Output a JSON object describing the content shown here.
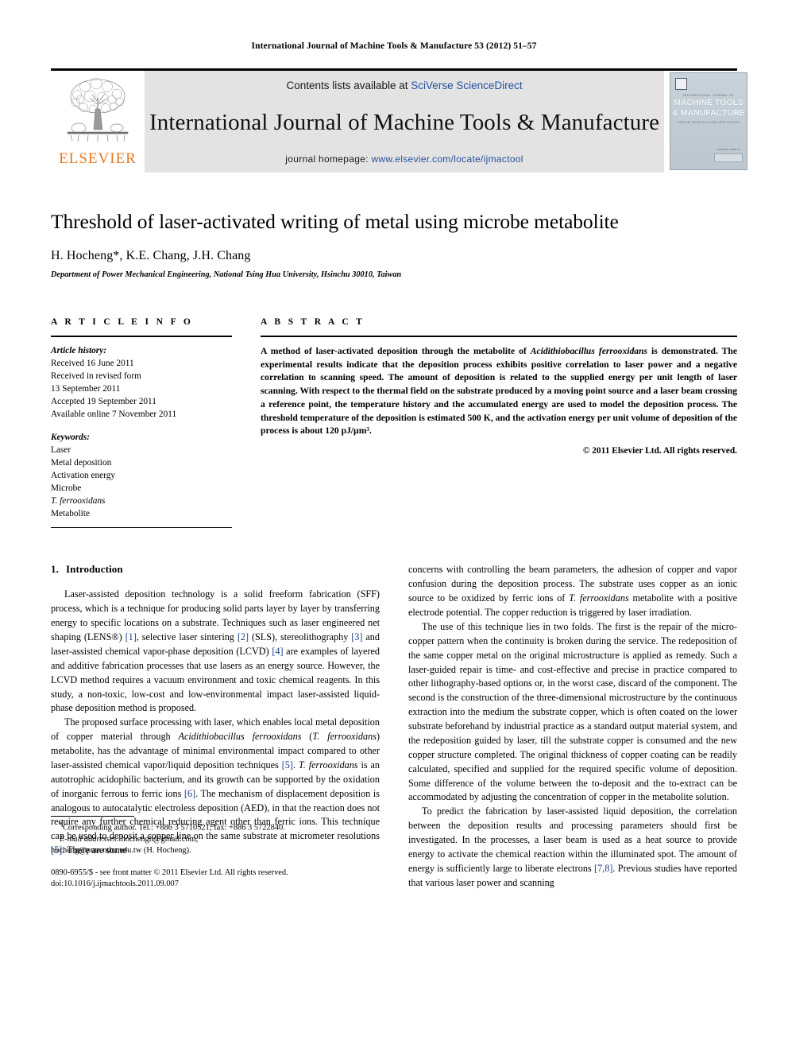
{
  "running_head": "International Journal of Machine Tools & Manufacture 53 (2012) 51–57",
  "masthead": {
    "publisher_name": "ELSEVIER",
    "contents_prefix": "Contents lists available at ",
    "contents_link": "SciVerse ScienceDirect",
    "journal_title": "International Journal of Machine Tools & Manufacture",
    "homepage_prefix": "journal homepage: ",
    "homepage_url": "www.elsevier.com/locate/ijmactool",
    "cover": {
      "kicker": "INTERNATIONAL JOURNAL OF",
      "title_line1": "MACHINE TOOLS",
      "title_line2": "& MANUFACTURE",
      "subtitle": "DESIGN, RESEARCH AND APPLICATION",
      "footer_label": "available online at",
      "footer_brand": "ScienceDirect"
    }
  },
  "article": {
    "title": "Threshold of laser-activated writing of metal using microbe metabolite",
    "authors": "H. Hocheng*, K.E. Chang, J.H. Chang",
    "affiliation": "Department of Power Mechanical Engineering, National Tsing Hua University, Hsinchu 30010, Taiwan"
  },
  "article_info": {
    "heading": "A R T I C L E    I N F O",
    "history_label": "Article history:",
    "history": [
      "Received 16 June 2011",
      "Received in revised form",
      "13 September 2011",
      "Accepted 19 September 2011",
      "Available online 7 November 2011"
    ],
    "keywords_label": "Keywords:",
    "keywords": [
      "Laser",
      "Metal deposition",
      "Activation energy",
      "Microbe",
      "T. ferrooxidans",
      "Metabolite"
    ]
  },
  "abstract": {
    "heading": "A B S T R A C T",
    "text_part1": "A method of laser-activated deposition through the metabolite of ",
    "organism": "Acidithiobacillus ferrooxidans",
    "text_part2": " is demonstrated. The experimental results indicate that the deposition process exhibits positive correlation to laser power and a negative correlation to scanning speed. The amount of deposition is related to the supplied energy per unit length of laser scanning. With respect to the thermal field on the substrate produced by a moving point source and a laser beam crossing a reference point, the temperature history and the accumulated energy are used to model the deposition process. The threshold temperature of the deposition is estimated 500 K, and the activation energy per unit volume of deposition of the process is about 120 pJ/µm³.",
    "copyright": "© 2011 Elsevier Ltd. All rights reserved."
  },
  "introduction": {
    "number": "1.",
    "title": "Introduction",
    "left_p1_a": "Laser-assisted deposition technology is a solid freeform fabrication (SFF) process, which is a technique for producing solid parts layer by layer by transferring energy to specific locations on a substrate. Techniques such as laser engineered net shaping (LENS®) ",
    "left_p1_r1": "[1]",
    "left_p1_b": ", selective laser sintering ",
    "left_p1_r2": "[2]",
    "left_p1_c": " (SLS), stereolithography ",
    "left_p1_r3": "[3]",
    "left_p1_d": " and laser-assisted chemical vapor-phase deposition (LCVD) ",
    "left_p1_r4": "[4]",
    "left_p1_e": " are examples of layered and additive fabrication processes that use lasers as an energy source. However, the LCVD method requires a vacuum environment and toxic chemical reagents. In this study, a non-toxic, low-cost and low-environmental impact laser-assisted liquid-phase deposition method is proposed.",
    "left_p2_a": "The proposed surface processing with laser, which enables local metal deposition of copper material through ",
    "left_p2_org1": "Acidithiobacillus ferrooxidans",
    "left_p2_b": " (",
    "left_p2_org2": "T. ferrooxidans",
    "left_p2_c": ") metabolite, has the advantage of minimal environmental impact compared to other laser-assisted chemical vapor/liquid deposition techniques ",
    "left_p2_r1": "[5]",
    "left_p2_d": ". ",
    "left_p2_org3": "T. ferrooxidans",
    "left_p2_e": " is an autotrophic acidophilic bacterium, and its growth can be supported by the oxidation of inorganic ferrous to ferric ions ",
    "left_p2_r2": "[6]",
    "left_p2_f": ". The mechanism of displacement deposition is analogous to autocatalytic electroless deposition (AED), in that the reaction does not require any further chemical reducing agent other than ferric ions. This technique can be used to deposit a copper line on the same substrate at micrometer resolutions ",
    "left_p2_r3": "[5]",
    "left_p2_g": ". There are some",
    "right_p1_a": "concerns with controlling the beam parameters, the adhesion of copper and vapor confusion during the deposition process. The substrate uses copper as an ionic source to be oxidized by ferric ions of ",
    "right_p1_org": "T. ferrooxidans",
    "right_p1_b": " metabolite with a positive electrode potential. The copper reduction is triggered by laser irradiation.",
    "right_p2": "The use of this technique lies in two folds. The first is the repair of the micro-copper pattern when the continuity is broken during the service. The redeposition of the same copper metal on the original microstructure is applied as remedy. Such a laser-guided repair is time- and cost-effective and precise in practice compared to other lithography-based options or, in the worst case, discard of the component. The second is the construction of the three-dimensional microstructure by the continuous extraction into the medium the substrate copper, which is often coated on the lower substrate beforehand by industrial practice as a standard output material system, and the redeposition guided by laser, till the substrate copper is consumed and the new copper structure completed. The original thickness of copper coating can be readily calculated, specified and supplied for the required specific volume of deposition. Some difference of the volume between the to-deposit and the to-extract can be accommodated by adjusting the concentration of copper in the metabolite solution.",
    "right_p3_a": "To predict the fabrication by laser-assisted liquid deposition, the correlation between the deposition results and processing parameters should first be investigated. In the processes, a laser beam is used as a heat source to provide energy to activate the chemical reaction within the illuminated spot. The amount of energy is sufficiently large to liberate electrons ",
    "right_p3_r1": "[7,8]",
    "right_p3_b": ". Previous studies have reported that various laser power and scanning"
  },
  "footnotes": {
    "corresponding_mark": "*",
    "corresponding": "Corresponding author. Tel.: +886 3 5710521; fax: +886 3 5722840.",
    "email_label": "E-mail addresses:",
    "email_1": " hochengh@gmail.com,",
    "email_2": "hocheng@pme.nthu.edu.tw (H. Hocheng).",
    "issn_line": "0890-6955/$ - see front matter © 2011 Elsevier Ltd. All rights reserved.",
    "doi_line": "doi:10.1016/j.ijmachtools.2011.09.007"
  }
}
